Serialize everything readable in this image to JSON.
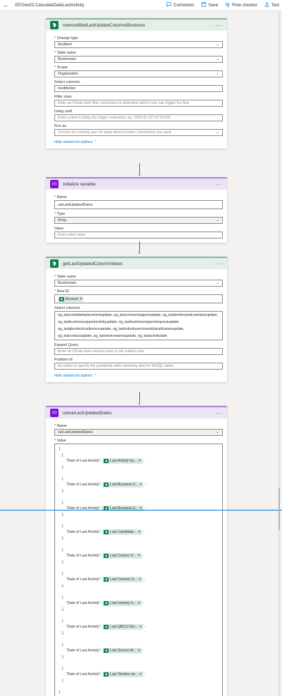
{
  "topbar": {
    "back_icon": "←",
    "title": "EP.Dev02.CalculateDateLastActivity",
    "comments": "Comments",
    "save": "Save",
    "flow_checker": "Flow checker",
    "test": "Test"
  },
  "card1": {
    "title": "rowmodifiedLastUpdateColumnsBusiness",
    "change_type_label": "Change type",
    "change_type_value": "Modified",
    "table_name_label": "Table name",
    "table_name_value": "Businesses",
    "scope_label": "Scope",
    "scope_value": "Organization",
    "select_columns_label": "Select columns",
    "select_columns_value": "modifiedon",
    "filter_rows_label": "Filter rows",
    "filter_rows_placeholder": "Enter an OData style filter expression to determine which rows can trigger the flow",
    "delay_until_label": "Delay until",
    "delay_until_placeholder": "Enter a time to delay the trigger evaluation, eg. 2020-01-01T10:10:00Z",
    "run_as_label": "Run as",
    "run_as_placeholder": "Choose the running user for steps where invoker connections are used",
    "hide_advanced": "Hide advanced options"
  },
  "card2": {
    "title": "Initialize variable",
    "name_label": "Name",
    "name_value": "varLastUpdatedDates",
    "type_label": "Type",
    "type_value": "Array",
    "value_label": "Value",
    "value_placeholder": "Enter initial value"
  },
  "card3": {
    "title": "getLastUpdatedColumnValues",
    "table_name_label": "Table name",
    "table_name_value": "Businesses",
    "row_id_label": "Row ID",
    "row_id_token": "Account",
    "select_columns_label": "Select columns",
    "select_columns_lines": [
      "og_lastcandidateplacementupdate, og_lastcontractsupportupdate, og_lasttendersandcontractsupdate,",
      "og_lastbusinesssupportactivityupdate, og_lastbusinesssupportrequestupdate,",
      "og_lastqbcelectricallicenceupdate, og_lastindustrysectorandclassificationupdate,",
      "og_lastcontactupdate, og_lastservicesareaupdate, og_lastactivitydate"
    ],
    "expand_query_label": "Expand Query",
    "expand_query_placeholder": "Enter an OData style expand query to list related rows",
    "partition_id_label": "Partition Id",
    "partition_id_placeholder": "An option to specify the partitionId while retrieving data for NoSQL tables",
    "hide_advanced": "Hide advanced options"
  },
  "card4": {
    "title": "setvarLastUpdatedDates",
    "name_label": "Name",
    "name_value": "varLastUpdatedDates",
    "value_label": "Value",
    "open_bracket": "[",
    "close_bracket": "]",
    "open_brace": "{",
    "close_brace": "},",
    "close_brace_last": "}",
    "key": "\"Date of Last Activity\":",
    "entries": [
      "Last Activity Da...",
      "Last Business S...",
      "Last Business S...",
      "Last Candidate...",
      "Last Contact U...",
      "Last Contract S...",
      "Last Industry S...",
      "Last QBCC/ Ele...",
      "Last Service Ar...",
      "Last Tenders an..."
    ]
  },
  "icons": {
    "dataverse": "dataverse-icon",
    "variable": "variable-icon"
  },
  "colors": {
    "accent": "#0078d4",
    "dataverse_green": "#0f7b4b",
    "variable_purple": "#770bd6",
    "required": "#a4262c"
  }
}
